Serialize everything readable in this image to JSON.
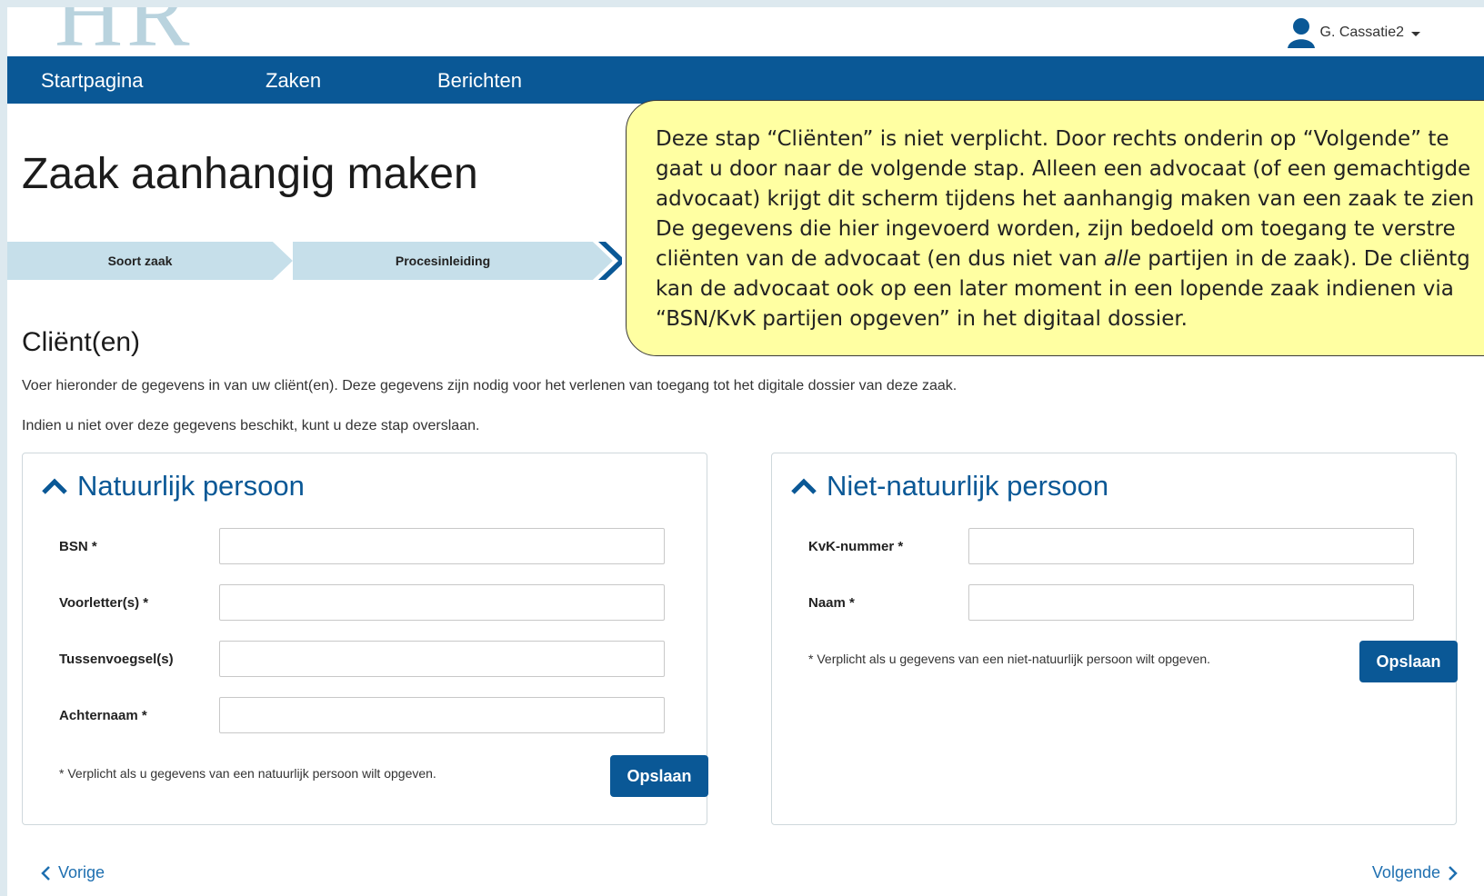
{
  "header": {
    "logo_text": "HR",
    "user_name": "G. Cassatie2"
  },
  "nav": {
    "items": [
      "Startpagina",
      "Zaken",
      "Berichten"
    ]
  },
  "page": {
    "title": "Zaak aanhangig maken"
  },
  "steps": {
    "items": [
      "Soort zaak",
      "Procesinleiding"
    ],
    "colors": {
      "step_bg": "#c6dfea",
      "brand": "#0a5896",
      "link": "#1e6fb0"
    }
  },
  "section": {
    "title": "Cliënt(en)",
    "intro_1": "Voer hieronder de gegevens in van uw cliënt(en). Deze gegevens zijn nodig voor het verlenen van toegang tot het digitale dossier van deze zaak.",
    "intro_2": "Indien u niet over deze gegevens beschikt, kunt u deze stap overslaan."
  },
  "natural_person": {
    "title": "Natuurlijk persoon",
    "fields": [
      {
        "label": "BSN *",
        "value": ""
      },
      {
        "label": "Voorletter(s) *",
        "value": ""
      },
      {
        "label": "Tussenvoegsel(s)",
        "value": ""
      },
      {
        "label": "Achternaam *",
        "value": ""
      }
    ],
    "note": "* Verplicht als u gegevens van een natuurlijk persoon wilt opgeven.",
    "save_label": "Opslaan"
  },
  "legal_person": {
    "title": "Niet-natuurlijk persoon",
    "fields": [
      {
        "label": "KvK-nummer *",
        "value": ""
      },
      {
        "label": "Naam *",
        "value": ""
      }
    ],
    "note": "* Verplicht als u gegevens van een niet-natuurlijk persoon wilt opgeven.",
    "save_label": "Opslaan"
  },
  "pager": {
    "prev_label": "Vorige",
    "next_label": "Volgende"
  },
  "callout": {
    "line_1": "Deze stap “Cliënten” is niet verplicht.  Door rechts onderin op “Volgende” te",
    "line_2": "gaat u door naar de volgende stap. Alleen een advocaat (of een gemachtigde",
    "line_3": "advocaat) krijgt dit scherm tijdens het aanhangig maken van een zaak te zien",
    "line_4": "De gegevens die hier ingevoerd worden, zijn bedoeld om toegang te verstre",
    "line_5a": "cliënten van de advocaat (en dus niet van ",
    "line_5_em": "alle",
    "line_5b": " partijen in de zaak). De cliëntg",
    "line_6": "kan de advocaat ook op een later moment in een lopende zaak indienen via",
    "line_7": "“BSN/KvK partijen opgeven” in het digitaal dossier."
  }
}
